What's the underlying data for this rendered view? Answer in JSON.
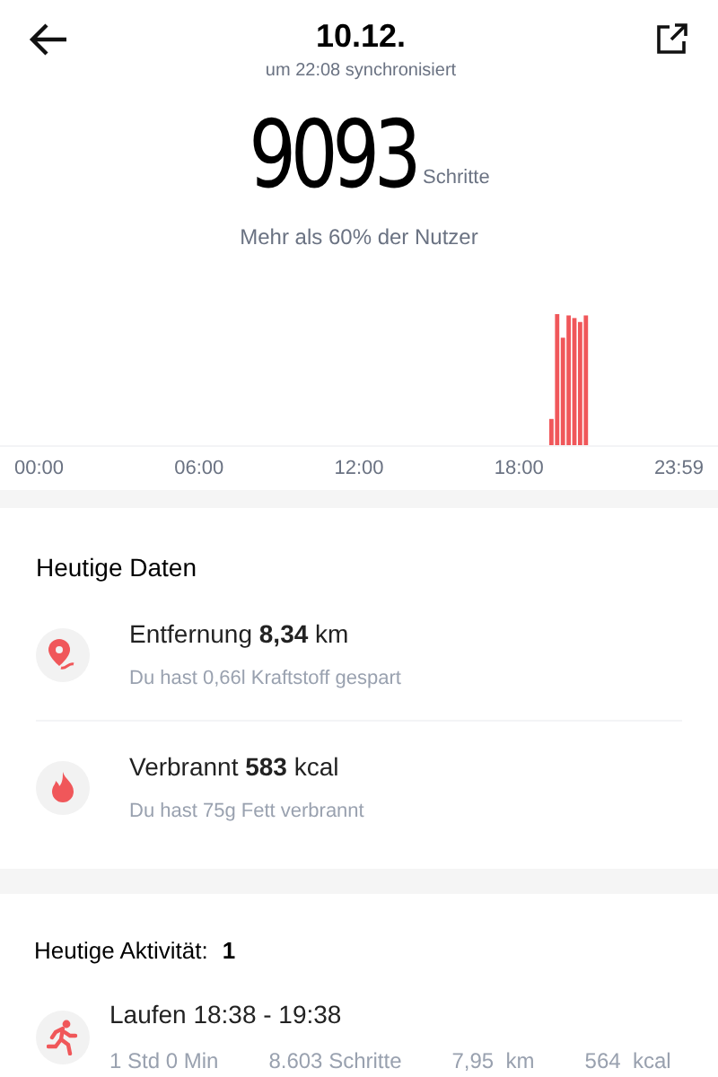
{
  "header": {
    "title": "10.12.",
    "subtitle": "um 22:08 synchronisiert"
  },
  "steps": {
    "value": "9093",
    "unit": "Schritte",
    "comparison": "Mehr als 60% der Nutzer"
  },
  "chart": {
    "axis_labels": [
      "00:00",
      "06:00",
      "12:00",
      "18:00",
      "23:59"
    ]
  },
  "today_data": {
    "title": "Heutige Daten",
    "items": [
      {
        "kind": "distance",
        "title": "Entfernung **8,34** km",
        "subtitle": "Du hast 0,66l Kraftstoff gespart"
      },
      {
        "kind": "calories",
        "title": "Verbrannt **583** kcal",
        "subtitle": "Du hast 75g Fett verbrannt"
      }
    ]
  },
  "activities": {
    "title": "Heutige Aktivität:",
    "count": "1",
    "items": [
      {
        "kind": "running",
        "title": "Laufen 18:38 - 19:38",
        "stats": [
          "1 Std 0 Min",
          "8.603 Schritte",
          "7,95  km",
          "564  kcal"
        ]
      }
    ]
  }
}
